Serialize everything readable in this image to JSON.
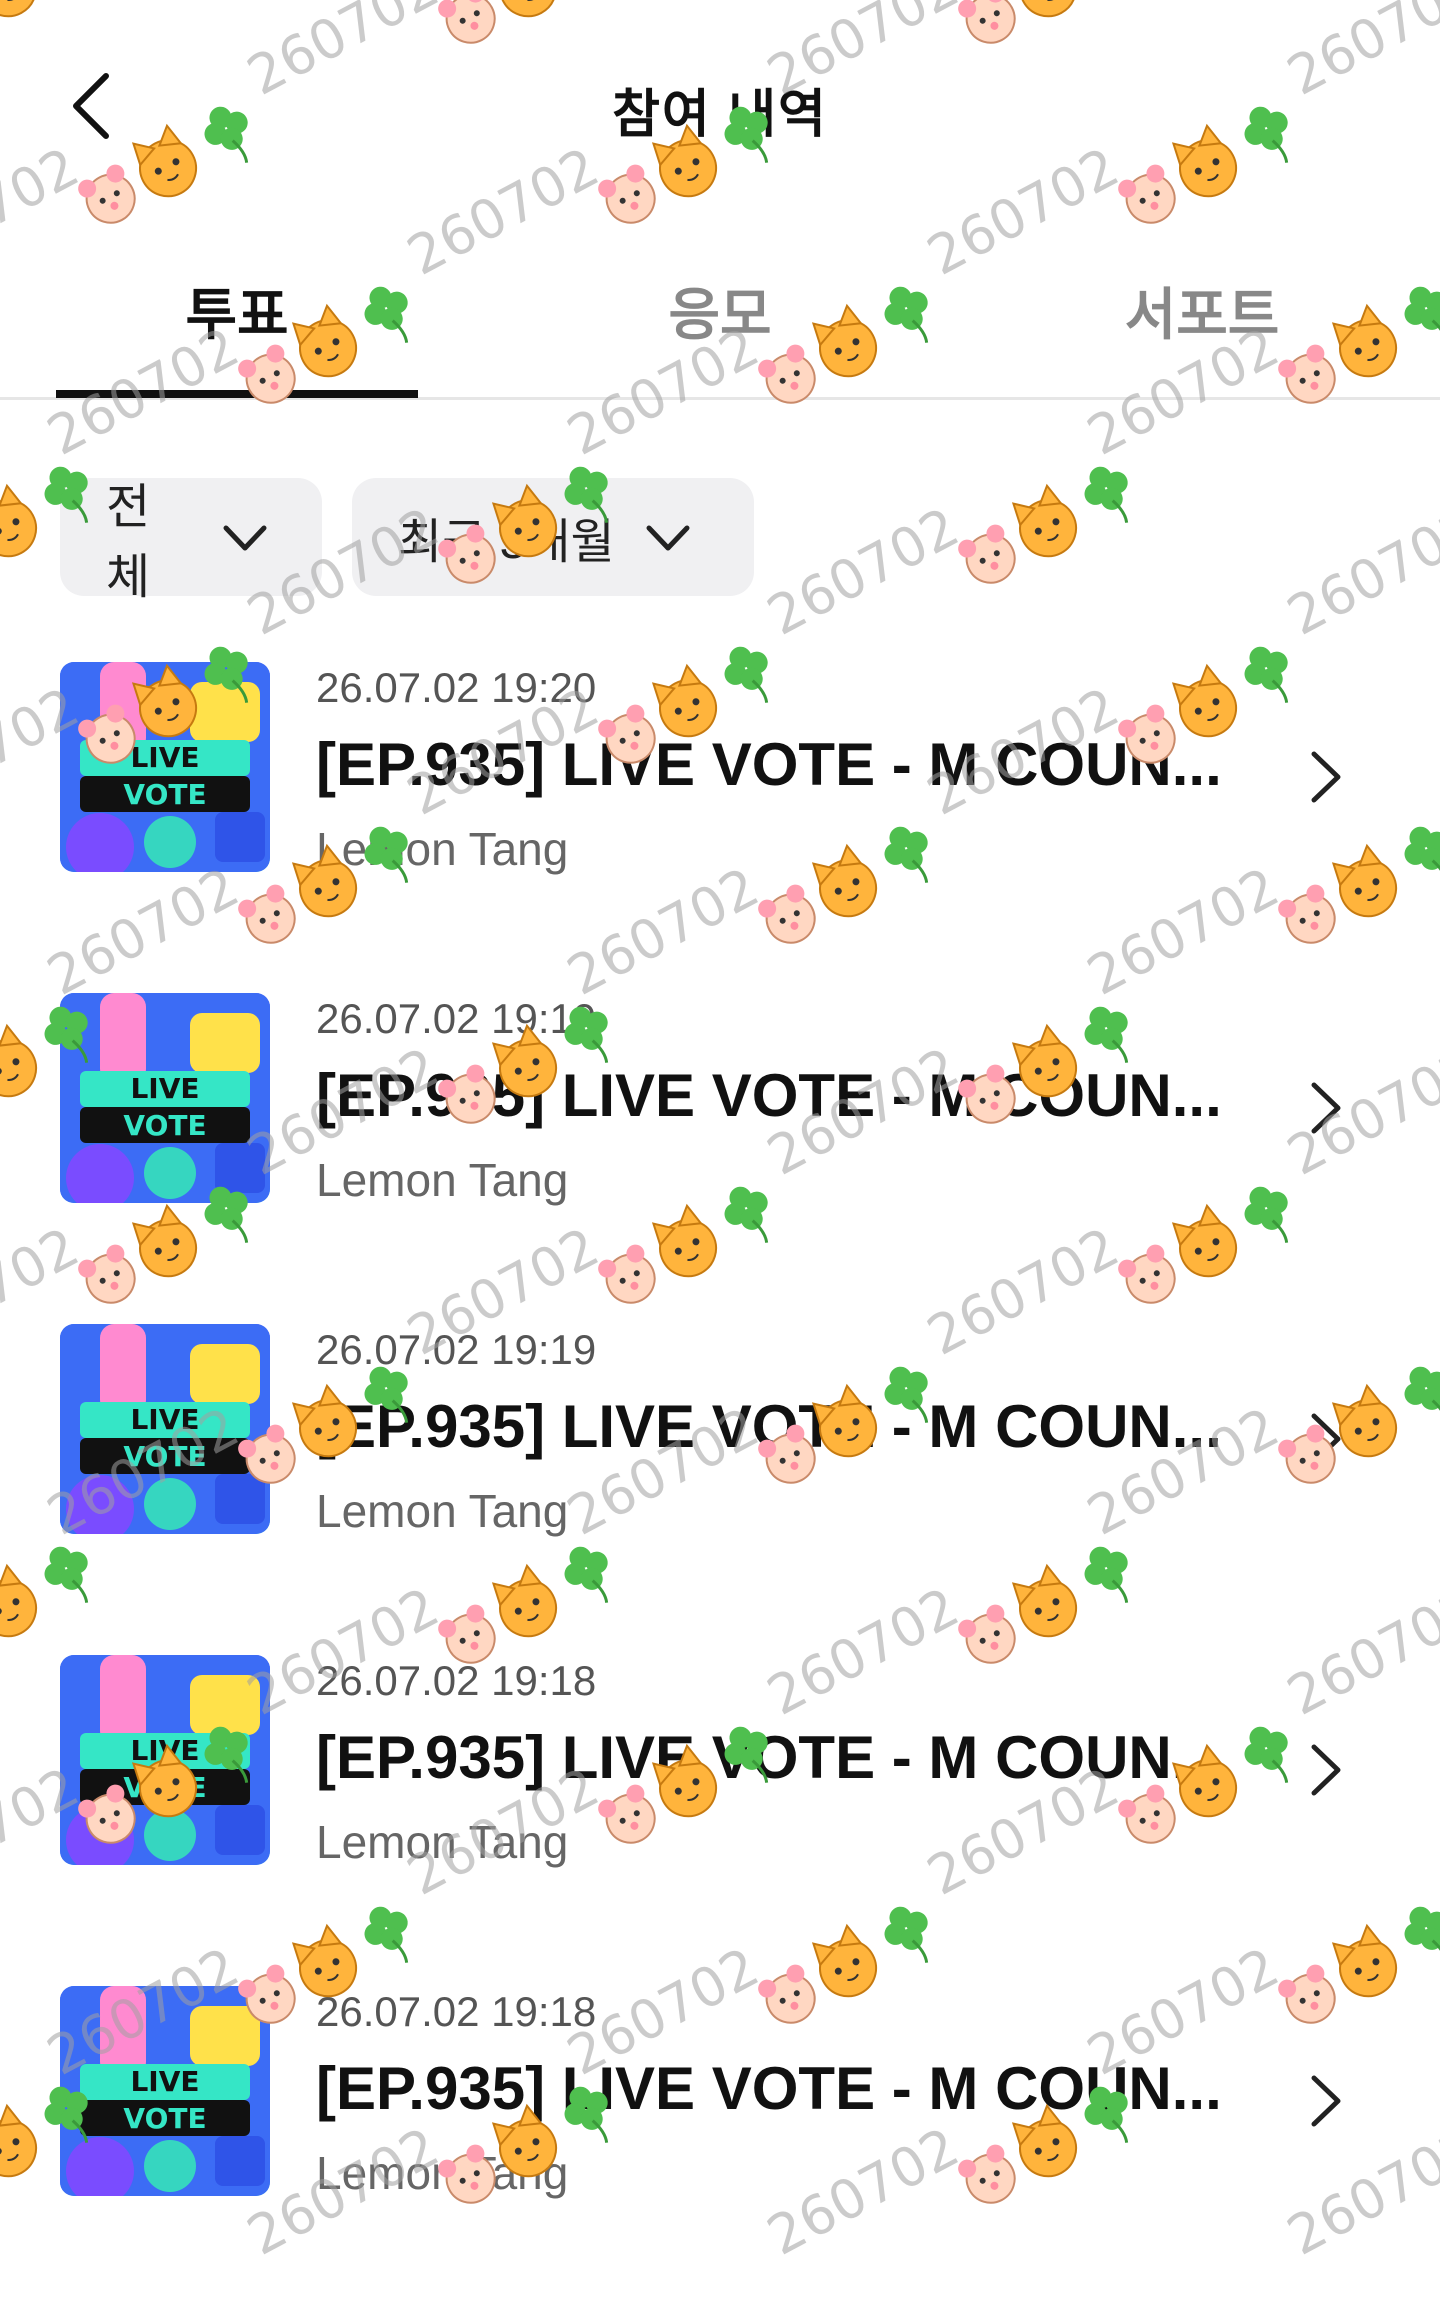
{
  "header": {
    "title": "참여 내역",
    "back_icon": "chevron-left-icon"
  },
  "tabs": [
    {
      "label": "투표",
      "active": true
    },
    {
      "label": "응모",
      "active": false
    },
    {
      "label": "서포트",
      "active": false
    }
  ],
  "filters": {
    "category": "전체",
    "period": "최근 3개월"
  },
  "items": [
    {
      "date": "26.07.02 19:20",
      "title": "[EP.935] LIVE VOTE - M COUN...",
      "subtitle": "Lemon Tang"
    },
    {
      "date": "26.07.02 19:19",
      "title": "[EP.935] LIVE VOTE - M COUN...",
      "subtitle": "Lemon Tang"
    },
    {
      "date": "26.07.02 19:19",
      "title": "[EP.935] LIVE VOTE - M COUN...",
      "subtitle": "Lemon Tang"
    },
    {
      "date": "26.07.02 19:18",
      "title": "[EP.935] LIVE VOTE - M COUN...",
      "subtitle": "Lemon Tang"
    },
    {
      "date": "26.07.02 19:18",
      "title": "[EP.935] LIVE VOTE - M COUN...",
      "subtitle": "Lemon Tang"
    }
  ],
  "thumbnail_text": [
    "LIVE",
    "VOTE"
  ],
  "watermark": {
    "text": "260702",
    "icons": [
      "hamster-icon",
      "cat-icon",
      "clover-icon"
    ]
  },
  "colors": {
    "text_primary": "#111111",
    "text_secondary": "#666666",
    "chip_bg": "#f0f0f2",
    "divider": "#e6e6e6",
    "watermark": "#a0a0a0"
  }
}
